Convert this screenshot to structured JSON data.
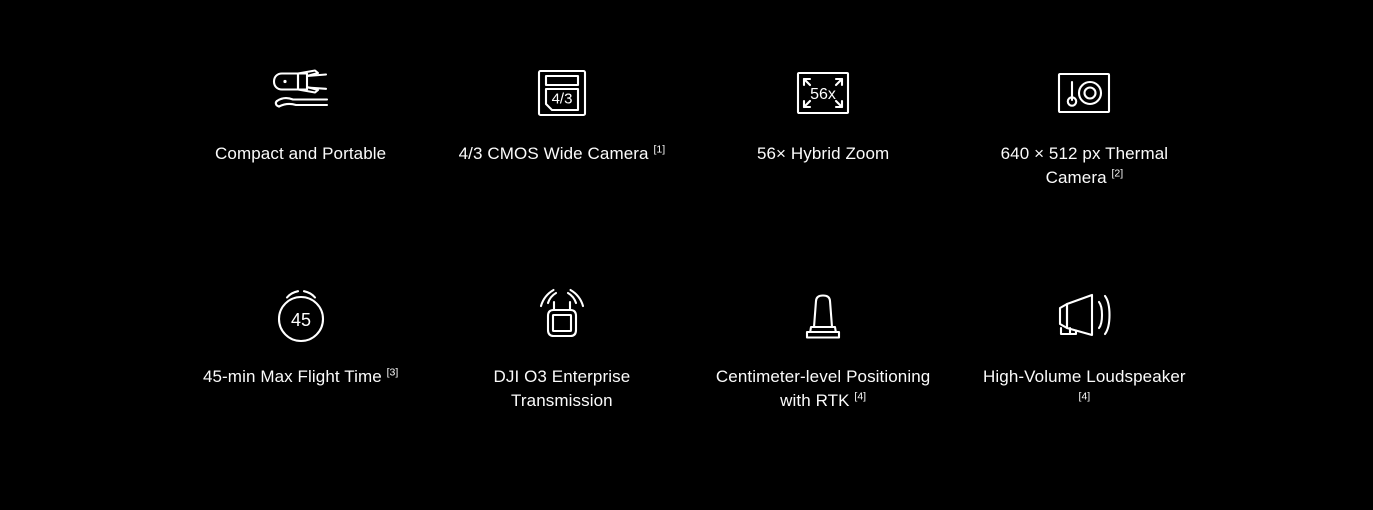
{
  "page": {
    "background_color": "#000000",
    "text_color": "#fbfbfb",
    "icon_stroke_color": "#ffffff"
  },
  "features": {
    "rows": [
      {
        "cells": [
          {
            "icon": "drone-on-hand-icon",
            "label": "Compact and Portable",
            "footnote": ""
          },
          {
            "icon": "cmos-sensor-43-icon",
            "label": "4/3 CMOS Wide Camera",
            "footnote": "[1]"
          },
          {
            "icon": "hybrid-zoom-56x-icon",
            "label": "56× Hybrid Zoom",
            "footnote": ""
          },
          {
            "icon": "thermal-camera-icon",
            "label": "640 × 512 px Thermal Camera",
            "footnote": "[2]"
          }
        ]
      },
      {
        "cells": [
          {
            "icon": "stopwatch-45-icon",
            "label": "45-min Max Flight Time",
            "footnote": "[3]"
          },
          {
            "icon": "remote-controller-signal-icon",
            "label": "DJI O3 Enterprise Transmission",
            "footnote": ""
          },
          {
            "icon": "rtk-module-icon",
            "label": "Centimeter-level Positioning with RTK",
            "footnote": "[4]"
          },
          {
            "icon": "loudspeaker-icon",
            "label": "High-Volume Loudspeaker",
            "footnote": "[4]"
          }
        ]
      }
    ],
    "icon_texts": {
      "sensor_format": "4/3",
      "zoom_factor": "56x",
      "flight_minutes": "45"
    }
  }
}
